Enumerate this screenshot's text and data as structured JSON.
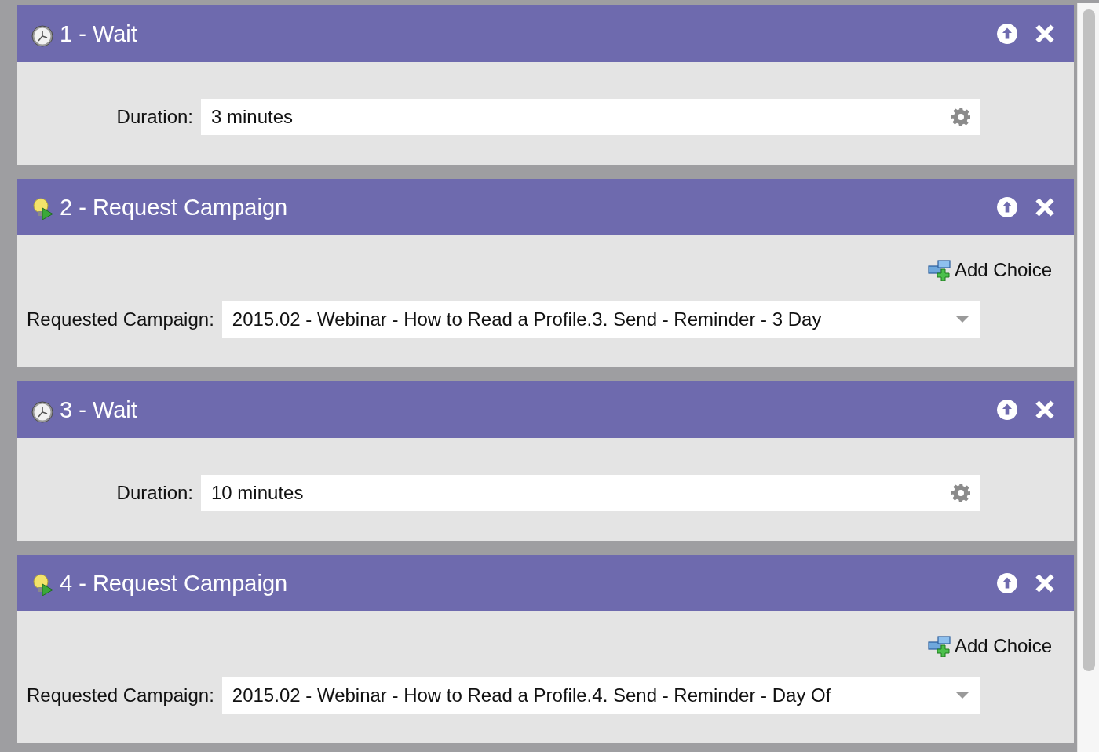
{
  "steps": [
    {
      "kind": "wait",
      "title": "1 - Wait",
      "label": "Duration:",
      "value": "3 minutes"
    },
    {
      "kind": "request_campaign",
      "title": "2 - Request Campaign",
      "add_choice": "Add Choice",
      "label": "Requested Campaign:",
      "value": "2015.02 - Webinar - How to Read a Profile.3. Send - Reminder - 3 Day"
    },
    {
      "kind": "wait",
      "title": "3 - Wait",
      "label": "Duration:",
      "value": "10 minutes"
    },
    {
      "kind": "request_campaign",
      "title": "4 - Request Campaign",
      "add_choice": "Add Choice",
      "label": "Requested Campaign:",
      "value": "2015.02 - Webinar - How to Read a Profile.4. Send - Reminder - Day Of"
    }
  ]
}
